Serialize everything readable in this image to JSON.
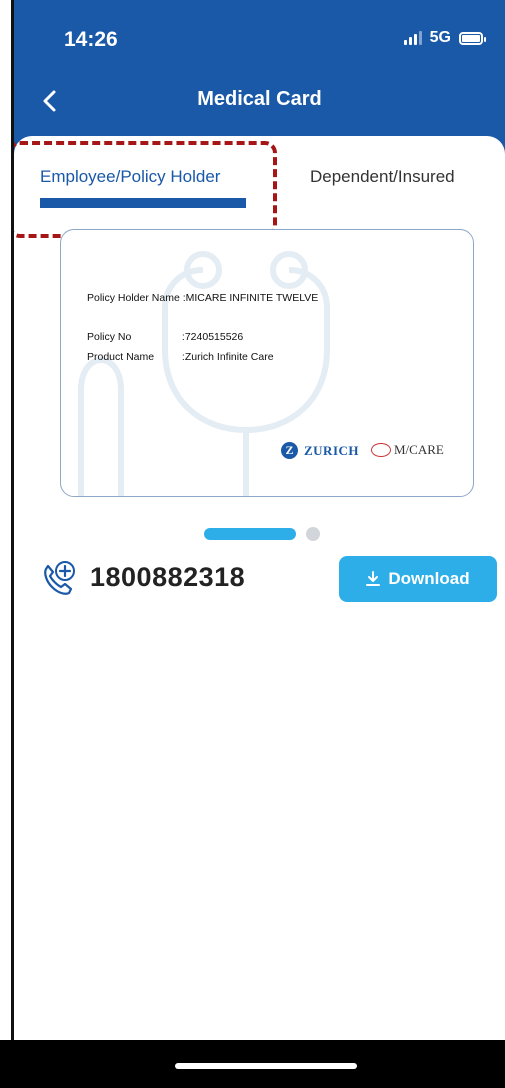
{
  "status_bar": {
    "time": "14:26",
    "network": "5G"
  },
  "nav": {
    "title": "Medical Card",
    "back_icon": "chevron-left-icon"
  },
  "tabs": [
    {
      "label": "Employee/Policy Holder",
      "selected": true
    },
    {
      "label": "Dependent/Insured",
      "selected": false
    }
  ],
  "card": {
    "holder_label": "Policy Holder Name",
    "holder_value": ":MICARE INFINITE TWELVE",
    "policy_label": "Policy No",
    "policy_value": ":7240515526",
    "product_label": "Product Name",
    "product_value": ":Zurich Infinite Care",
    "logo_zurich": "ZURICH",
    "logo_micare": "M/CARE"
  },
  "pager": {
    "current": 1,
    "total": 2
  },
  "contact": {
    "phone": "1800882318",
    "icon": "phone-medical-icon"
  },
  "download_label": "Download",
  "colors": {
    "primary": "#1a58a8",
    "accent": "#2eaee8",
    "highlight": "#a61616"
  }
}
